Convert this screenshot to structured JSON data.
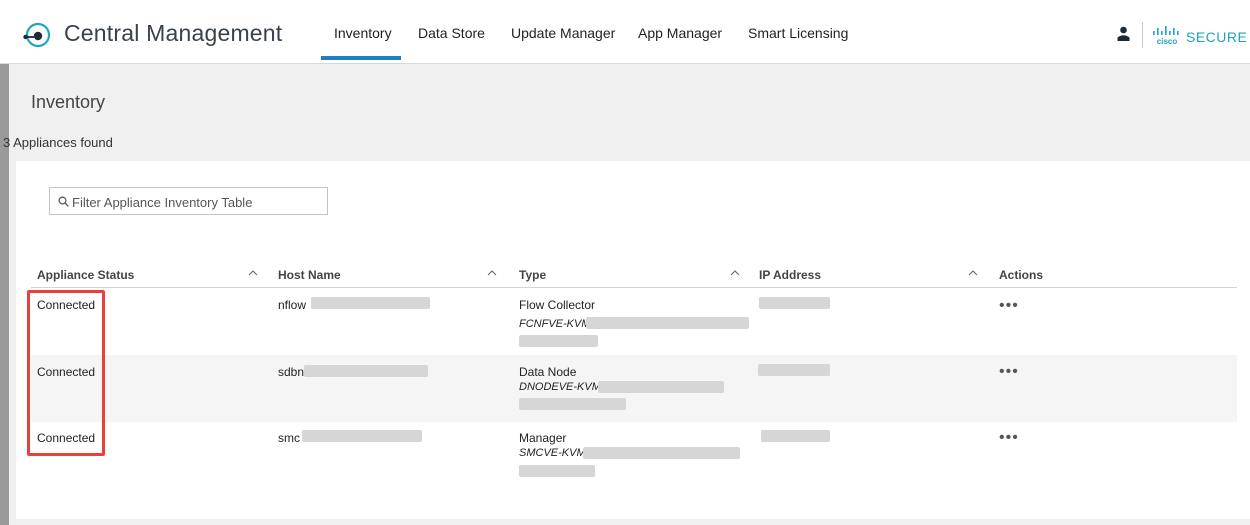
{
  "header": {
    "app_title": "Central Management",
    "nav": [
      "Inventory",
      "Data Store",
      "Update Manager",
      "App Manager",
      "Smart Licensing"
    ],
    "active_nav": "Inventory",
    "brand": "SECURE",
    "cisco_word": "cisco"
  },
  "page": {
    "title": "Inventory",
    "count_text": "3 Appliances found",
    "filter_placeholder": "Filter Appliance Inventory Table"
  },
  "table": {
    "columns": [
      "Appliance Status",
      "Host Name",
      "Type",
      "IP Address",
      "Actions"
    ],
    "rows": [
      {
        "status": "Connected",
        "host": "nflow",
        "type": "Flow Collector",
        "type_sub": "FCNFVE-KVM",
        "actions": "..."
      },
      {
        "status": "Connected",
        "host": "sdbn",
        "type": "Data Node",
        "type_sub": "DNODEVE-KVM",
        "actions": "..."
      },
      {
        "status": "Connected",
        "host": "smc",
        "type": "Manager",
        "type_sub": "SMCVE-KVM",
        "actions": "..."
      }
    ]
  },
  "colors": {
    "accent": "#1e7fbf",
    "brand": "#1ea5bf",
    "highlight": "#e8413d"
  }
}
